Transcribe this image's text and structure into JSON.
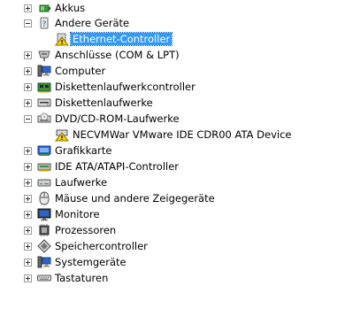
{
  "tree": {
    "items": [
      {
        "label": "Akkus",
        "icon": "battery-icon"
      },
      {
        "label": "Andere Geräte",
        "icon": "unknown-device-icon"
      },
      {
        "label": "Ethernet-Controller",
        "icon": "warning-device-icon"
      },
      {
        "label": "Anschlüsse (COM & LPT)",
        "icon": "port-icon"
      },
      {
        "label": "Computer",
        "icon": "computer-icon"
      },
      {
        "label": "Diskettenlaufwerkcontroller",
        "icon": "floppy-controller-icon"
      },
      {
        "label": "Diskettenlaufwerke",
        "icon": "floppy-drive-icon"
      },
      {
        "label": "DVD/CD-ROM-Laufwerke",
        "icon": "dvd-drive-icon"
      },
      {
        "label": "NECVMWar VMware IDE CDR00 ATA Device",
        "icon": "warning-dvd-icon"
      },
      {
        "label": "Grafikkarte",
        "icon": "display-adapter-icon"
      },
      {
        "label": "IDE ATA/ATAPI-Controller",
        "icon": "ide-controller-icon"
      },
      {
        "label": "Laufwerke",
        "icon": "disk-drive-icon"
      },
      {
        "label": "Mäuse und andere Zeigegeräte",
        "icon": "mouse-icon"
      },
      {
        "label": "Monitore",
        "icon": "monitor-icon"
      },
      {
        "label": "Prozessoren",
        "icon": "processor-icon"
      },
      {
        "label": "Speichercontroller",
        "icon": "storage-controller-icon"
      },
      {
        "label": "Systemgeräte",
        "icon": "system-device-icon"
      },
      {
        "label": "Tastaturen",
        "icon": "keyboard-icon"
      }
    ]
  }
}
